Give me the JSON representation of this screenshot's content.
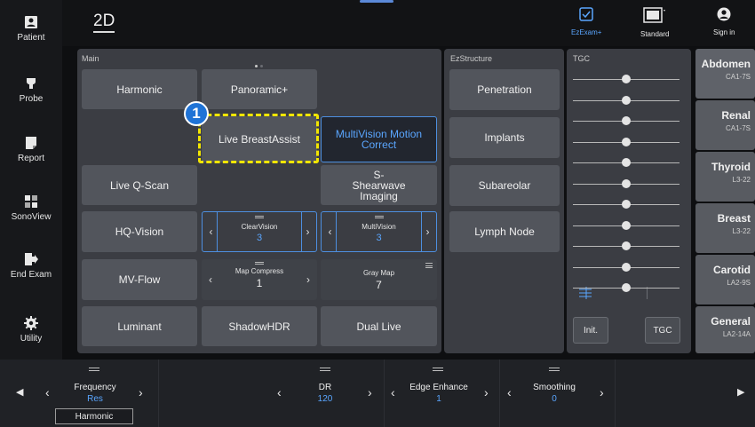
{
  "nav": {
    "patient": "Patient",
    "probe": "Probe",
    "report": "Report",
    "sonoview": "SonoView",
    "end_exam": "End Exam",
    "utility": "Utility"
  },
  "header": {
    "mode": "2D",
    "ezexam": "EzExam+",
    "standard": "Standard",
    "sign_in": "Sign in"
  },
  "main": {
    "title": "Main",
    "buttons": {
      "harmonic": "Harmonic",
      "panoramic": "Panoramic+",
      "live_breastassist": "Live BreastAssist",
      "multivision_motion": "MultiVision Motion Correct",
      "live_qscan": "Live Q-Scan",
      "shearwave": "S-Shearwave Imaging",
      "hq_vision": "HQ-Vision",
      "mv_flow": "MV-Flow",
      "luminant": "Luminant",
      "shadowhdr": "ShadowHDR",
      "dual_live": "Dual Live"
    },
    "steppers": {
      "clearvision": {
        "name": "ClearVision",
        "value": "3"
      },
      "multivision": {
        "name": "MultiVision",
        "value": "3"
      },
      "map_compress": {
        "name": "Map Compress",
        "value": "1"
      },
      "gray_map": {
        "name": "Gray Map",
        "value": "7"
      }
    },
    "callout": "1"
  },
  "ezstructure": {
    "title": "EzStructure",
    "items": [
      "Penetration",
      "Implants",
      "Subareolar",
      "Lymph Node"
    ]
  },
  "tgc": {
    "title": "TGC",
    "init": "Init.",
    "tgc_button": "TGC",
    "sliders": [
      0.5,
      0.5,
      0.5,
      0.5,
      0.5,
      0.5,
      0.5,
      0.5,
      0.5,
      0.5,
      0.5
    ]
  },
  "presets": [
    {
      "name": "Abdomen",
      "probe": "CA1-7S"
    },
    {
      "name": "Renal",
      "probe": "CA1-7S"
    },
    {
      "name": "Thyroid",
      "probe": "L3-22"
    },
    {
      "name": "Breast",
      "probe": "L3-22"
    },
    {
      "name": "Carotid",
      "probe": "LA2-9S"
    },
    {
      "name": "General",
      "probe": "LA2-14A"
    }
  ],
  "bottom": {
    "frequency": {
      "name": "Frequency",
      "value": "Res",
      "mode": "Harmonic"
    },
    "dr": {
      "name": "DR",
      "value": "120"
    },
    "edge_enhance": {
      "name": "Edge Enhance",
      "value": "1"
    },
    "smoothing": {
      "name": "Smoothing",
      "value": "0"
    }
  },
  "colors": {
    "accent": "#4d8fe0",
    "highlight": "#f2e600",
    "value_blue": "#5aa6ff"
  }
}
